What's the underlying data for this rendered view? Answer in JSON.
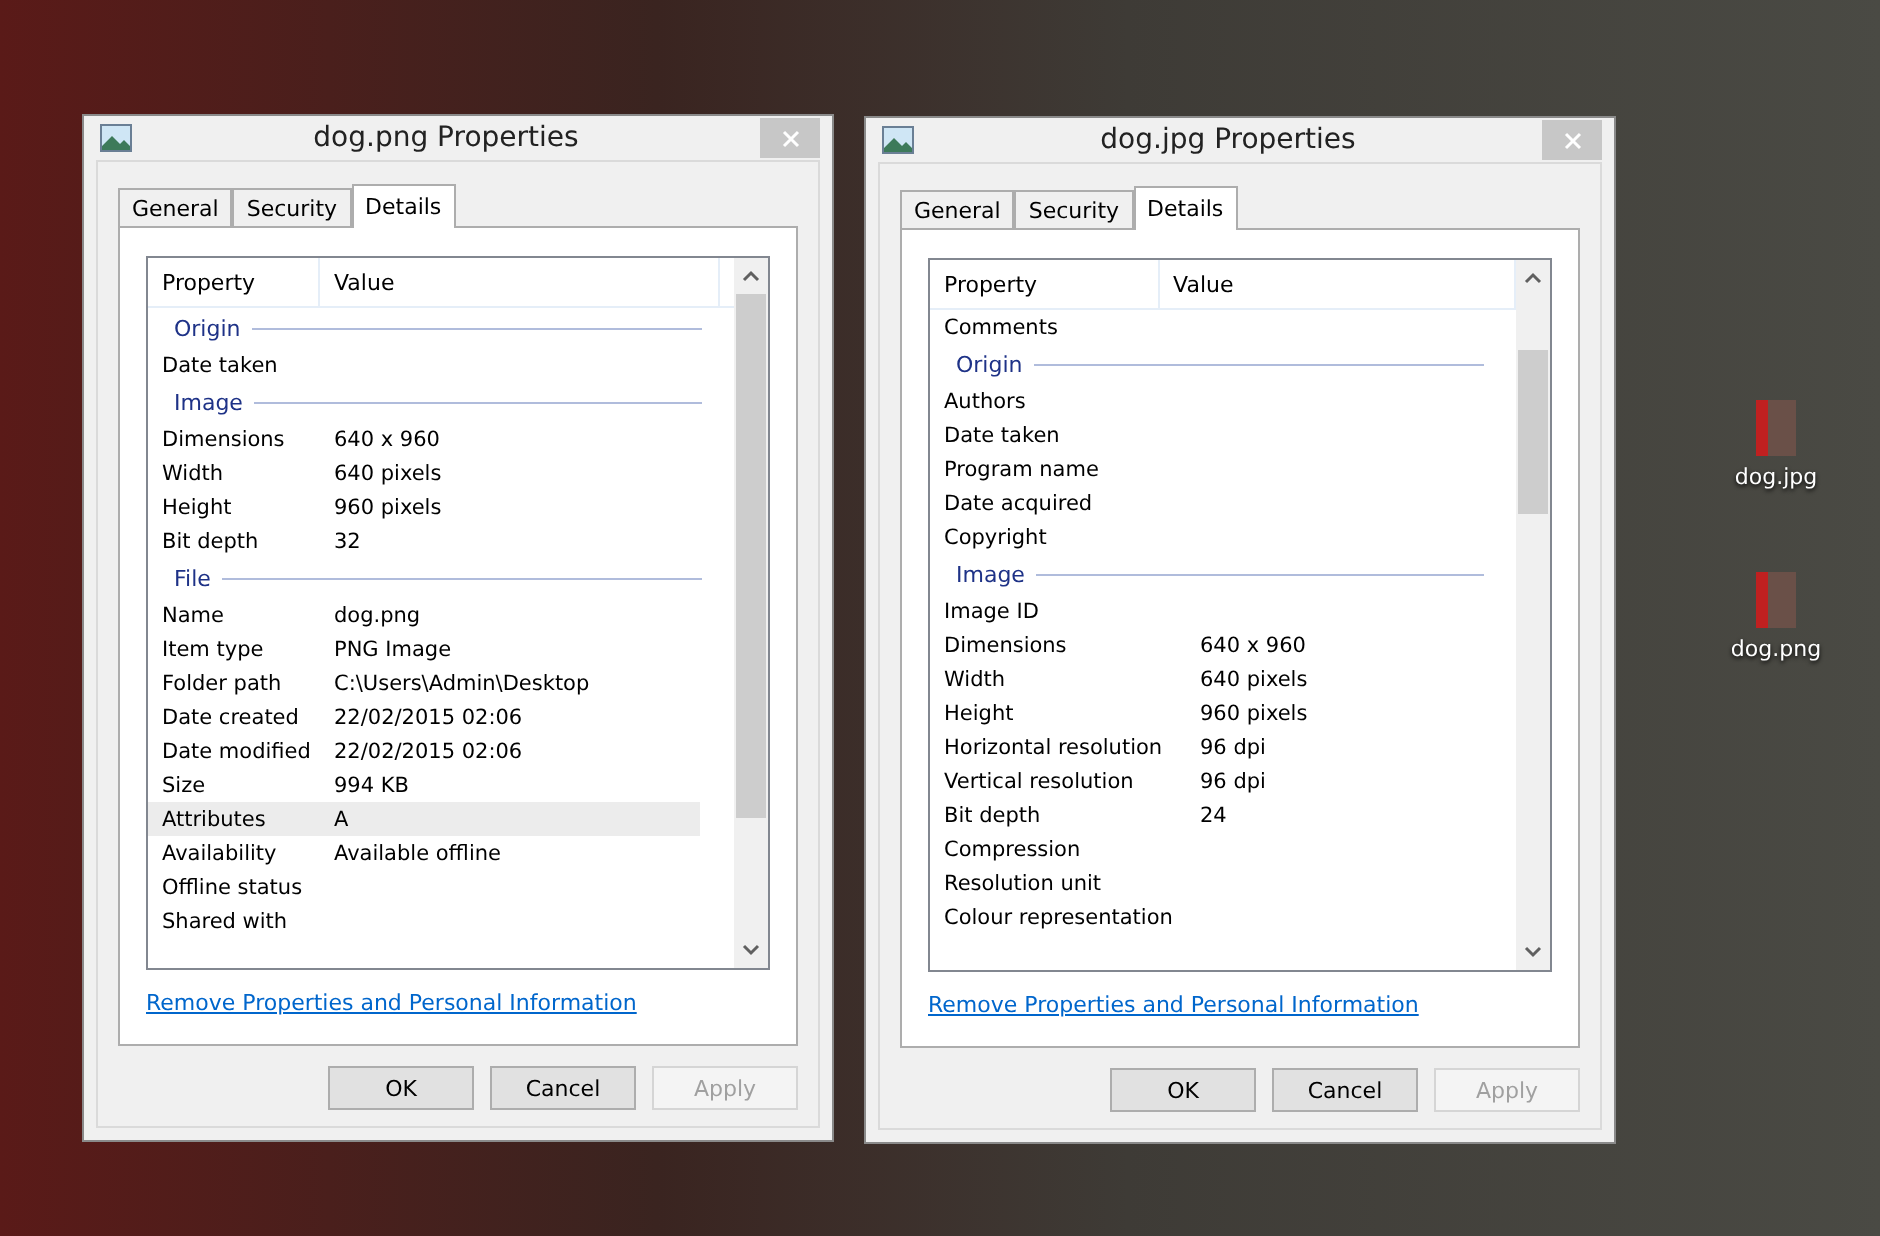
{
  "dialogs": [
    {
      "title": "dog.png Properties",
      "tabs": [
        {
          "label": "General",
          "selected": false
        },
        {
          "label": "Security",
          "selected": false
        },
        {
          "label": "Details",
          "selected": true
        }
      ],
      "columns": [
        "Property",
        "Value"
      ],
      "rows": [
        {
          "kind": "heading",
          "label": "Origin"
        },
        {
          "kind": "row",
          "property": "Date taken",
          "selected": false
        },
        {
          "kind": "heading",
          "label": "Image"
        },
        {
          "kind": "row",
          "property": "Dimensions",
          "value": "640 x 960",
          "selected": false
        },
        {
          "kind": "row",
          "property": "Width",
          "value": "640 pixels",
          "selected": false
        },
        {
          "kind": "row",
          "property": "Height",
          "value": "960 pixels",
          "selected": false
        },
        {
          "kind": "row",
          "property": "Bit depth",
          "value": "32",
          "selected": false
        },
        {
          "kind": "heading",
          "label": "File"
        },
        {
          "kind": "row",
          "property": "Name",
          "value": "dog.png",
          "selected": false
        },
        {
          "kind": "row",
          "property": "Item type",
          "value": "PNG Image",
          "selected": false
        },
        {
          "kind": "row",
          "property": "Folder path",
          "value": "C:\\Users\\Admin\\Desktop",
          "selected": false
        },
        {
          "kind": "row",
          "property": "Date created",
          "value": "22/02/2015 02:06",
          "selected": false
        },
        {
          "kind": "row",
          "property": "Date modified",
          "value": "22/02/2015 02:06",
          "selected": false
        },
        {
          "kind": "row",
          "property": "Size",
          "value": "994 KB",
          "selected": false
        },
        {
          "kind": "row",
          "property": "Attributes",
          "value": "A",
          "selected": true
        },
        {
          "kind": "row",
          "property": "Availability",
          "value": "Available offline",
          "selected": false
        },
        {
          "kind": "row",
          "property": "Offline status",
          "selected": false
        },
        {
          "kind": "row",
          "property": "Shared with",
          "selected": false
        }
      ],
      "link": "Remove Properties and Personal Information",
      "buttons": [
        {
          "label": "OK",
          "disabled": false
        },
        {
          "label": "Cancel",
          "disabled": false
        },
        {
          "label": "Apply",
          "disabled": true
        }
      ]
    },
    {
      "title": "dog.jpg Properties",
      "tabs": [
        {
          "label": "General",
          "selected": false
        },
        {
          "label": "Security",
          "selected": false
        },
        {
          "label": "Details",
          "selected": true
        }
      ],
      "columns": [
        "Property",
        "Value"
      ],
      "rows": [
        {
          "kind": "row",
          "property": "Comments",
          "selected": false
        },
        {
          "kind": "heading",
          "label": "Origin"
        },
        {
          "kind": "row",
          "property": "Authors",
          "selected": false
        },
        {
          "kind": "row",
          "property": "Date taken",
          "selected": false
        },
        {
          "kind": "row",
          "property": "Program name",
          "selected": false
        },
        {
          "kind": "row",
          "property": "Date acquired",
          "selected": false
        },
        {
          "kind": "row",
          "property": "Copyright",
          "selected": false
        },
        {
          "kind": "heading",
          "label": "Image"
        },
        {
          "kind": "row",
          "property": "Image ID",
          "selected": false
        },
        {
          "kind": "row",
          "property": "Dimensions",
          "value": "640 x 960",
          "selected": false
        },
        {
          "kind": "row",
          "property": "Width",
          "value": "640 pixels",
          "selected": false
        },
        {
          "kind": "row",
          "property": "Height",
          "value": "960 pixels",
          "selected": false
        },
        {
          "kind": "row",
          "property": "Horizontal resolution",
          "value": "96 dpi",
          "selected": false
        },
        {
          "kind": "row",
          "property": "Vertical resolution",
          "value": "96 dpi",
          "selected": false
        },
        {
          "kind": "row",
          "property": "Bit depth",
          "value": "24",
          "selected": false
        },
        {
          "kind": "row",
          "property": "Compression",
          "selected": false
        },
        {
          "kind": "row",
          "property": "Resolution unit",
          "selected": false
        },
        {
          "kind": "row",
          "property": "Colour representation",
          "selected": false
        }
      ],
      "link": "Remove Properties and Personal Information",
      "buttons": [
        {
          "label": "OK",
          "disabled": false
        },
        {
          "label": "Cancel",
          "disabled": false
        },
        {
          "label": "Apply",
          "disabled": true
        }
      ]
    }
  ],
  "desktop_icons": [
    {
      "label": "dog.jpg"
    },
    {
      "label": "dog.png"
    }
  ]
}
